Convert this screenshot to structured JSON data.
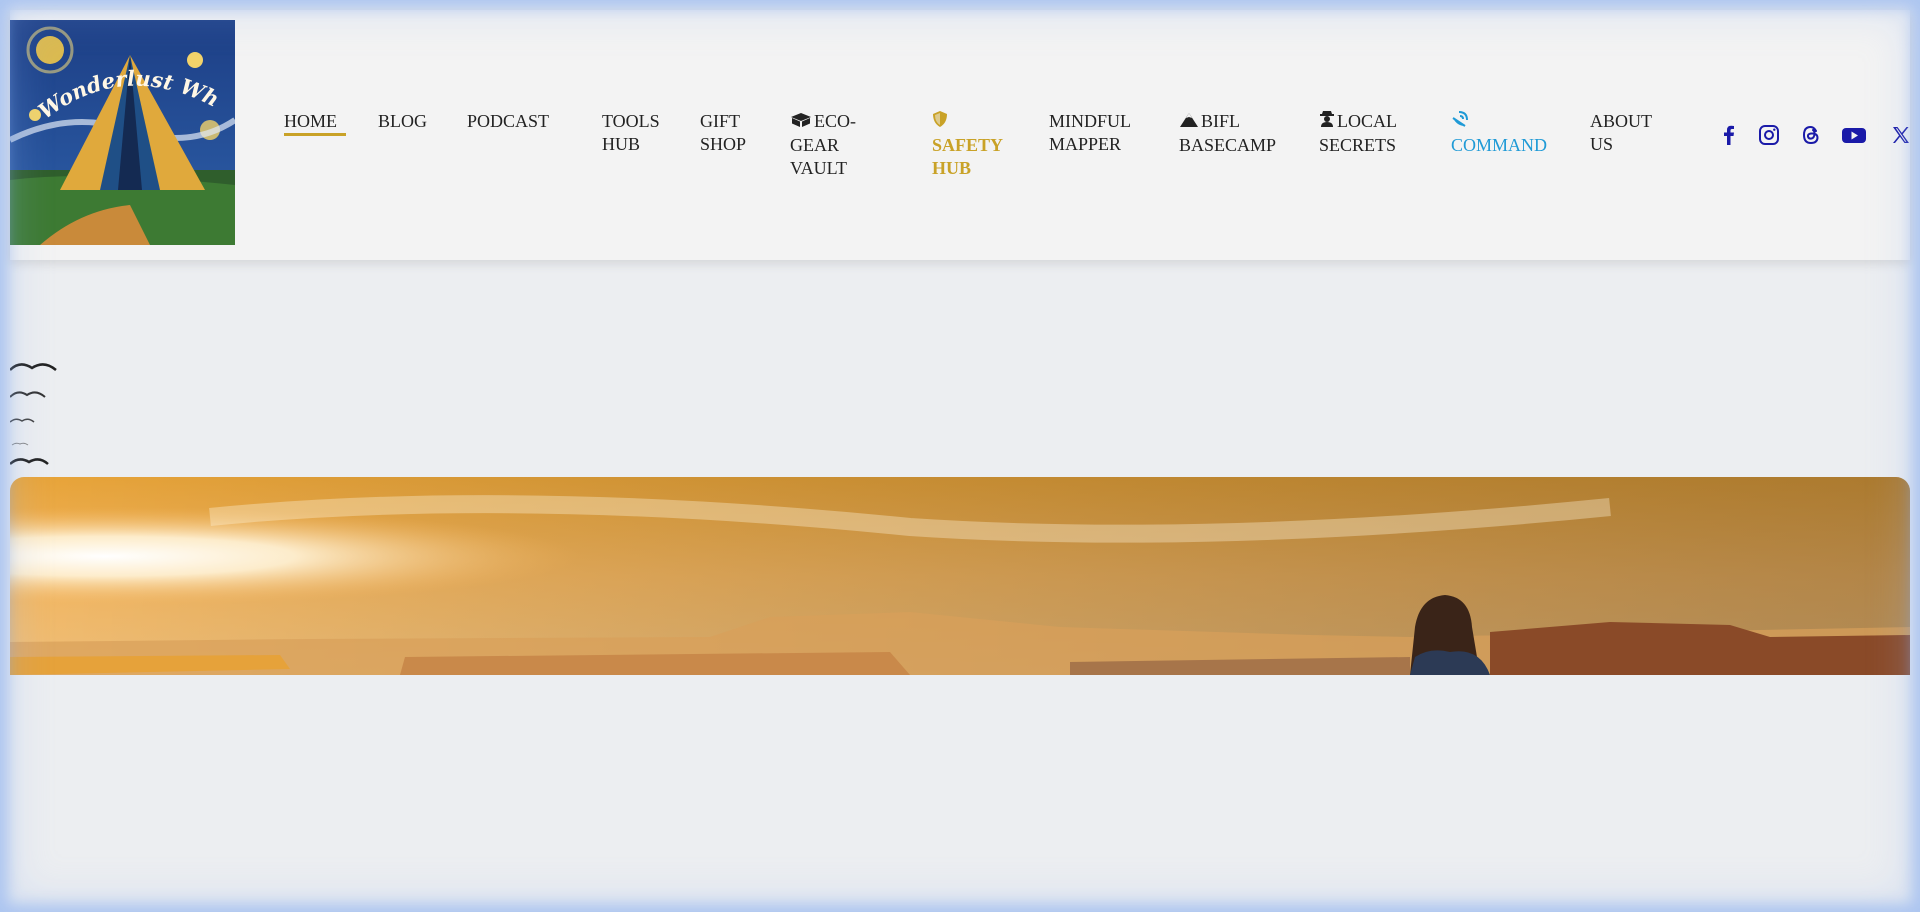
{
  "logo": {
    "alt_text": "Wonderlust Whispers"
  },
  "nav": {
    "items": [
      {
        "label": "HOME",
        "icon": ""
      },
      {
        "label": "BLOG",
        "icon": ""
      },
      {
        "label": "PODCAST",
        "icon": ""
      },
      {
        "label": "TOOLS HUB",
        "icon": ""
      },
      {
        "label": "GIFT SHOP",
        "icon": ""
      },
      {
        "label": "ECO-GEAR VAULT",
        "icon": "box-open-icon"
      },
      {
        "label": "SAFETY HUB",
        "icon": "shield-icon"
      },
      {
        "label": "MINDFUL MAPPER",
        "icon": ""
      },
      {
        "label": "BIFL BASECAMP",
        "icon": "mountain-icon"
      },
      {
        "label": "LOCAL SECRETS",
        "icon": "user-secret-icon"
      },
      {
        "label": "COMMAND",
        "icon": "satellite-dish-icon"
      },
      {
        "label": "ABOUT US",
        "icon": ""
      }
    ],
    "active_color": "#c9a227",
    "safety_color": "#c9a227",
    "command_color": "#1f9ad6",
    "text_color": "#222222"
  },
  "social": {
    "icons": [
      "facebook-icon",
      "instagram-icon",
      "threads-icon",
      "youtube-icon",
      "x-twitter-icon"
    ],
    "color": "#1a1aa8"
  },
  "hero": {
    "description": "desert canyon sunset with hiker"
  }
}
